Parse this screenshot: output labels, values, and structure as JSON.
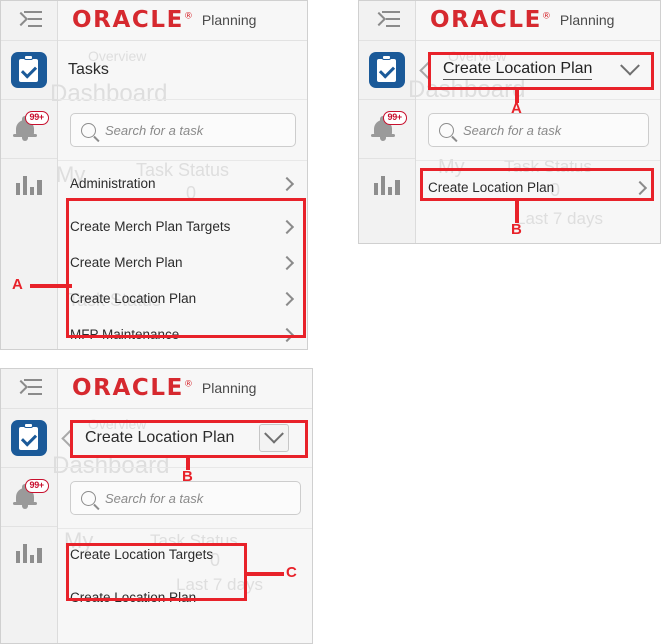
{
  "brand": {
    "name": "ORACLE",
    "reg": "®",
    "product": "Planning"
  },
  "rail": {
    "items": [
      {
        "name": "nav-collapse-icon",
        "label": "Navigator"
      },
      {
        "name": "tasks-icon",
        "label": "Tasks"
      },
      {
        "name": "notifications-icon",
        "label": "Notifications",
        "badge": "99+"
      },
      {
        "name": "reports-icon",
        "label": "Reports"
      }
    ]
  },
  "search": {
    "placeholder": "Search for a task"
  },
  "ghost": {
    "overview": "Overview",
    "dashboard": "Dashboard",
    "my": "My",
    "task_status": "Task Status",
    "zero": "0",
    "last_7_days": "Last 7 days"
  },
  "panel1": {
    "header": "Tasks",
    "items": [
      {
        "label": "Administration",
        "chevron": "chevron-right-icon"
      },
      {
        "label": "Create Merch Plan Targets",
        "chevron": "chevron-right-icon"
      },
      {
        "label": "Create Merch Plan",
        "chevron": "chevron-right-icon"
      },
      {
        "label": "Create Location Plan",
        "chevron": "chevron-right-icon"
      },
      {
        "label": "MFP Maintenance",
        "chevron": "chevron-right-icon"
      }
    ],
    "callout": "A"
  },
  "panel2": {
    "title": "Create Location Plan",
    "items": [
      {
        "label": "Create Location Plan",
        "chevron": "chevron-right-icon"
      }
    ],
    "callout_title": "A",
    "callout_list": "B"
  },
  "panel3": {
    "title": "Create Location Plan",
    "items": [
      {
        "label": "Create Location Targets"
      },
      {
        "label": "Create Location Plan"
      }
    ],
    "callout_title": "B",
    "callout_list": "C"
  },
  "colors": {
    "annotation_red": "#e8222a",
    "oracle_red": "#d6292f",
    "tile_blue": "#1b5a99",
    "badge_red": "#c8102e"
  }
}
